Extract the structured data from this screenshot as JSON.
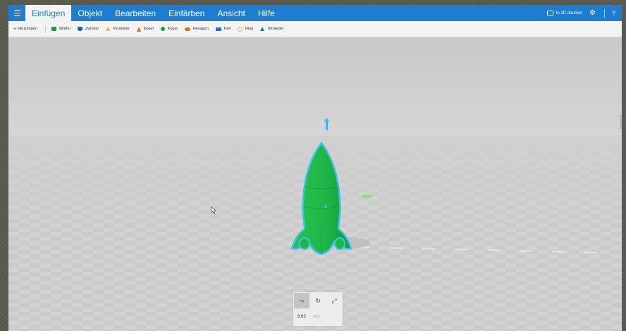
{
  "menubar": {
    "tabs": [
      {
        "label": "Einfügen",
        "active": true
      },
      {
        "label": "Objekt",
        "active": false
      },
      {
        "label": "Bearbeiten",
        "active": false
      },
      {
        "label": "Einfärben",
        "active": false
      },
      {
        "label": "Ansicht",
        "active": false
      },
      {
        "label": "Hilfe",
        "active": false
      }
    ],
    "print_label": "In 3D drucken",
    "gear_icon": "gear-icon",
    "help_icon": "?"
  },
  "toolbar": {
    "add_label": "Hinzufügen",
    "shapes": [
      {
        "label": "Würfel",
        "icon": "cube"
      },
      {
        "label": "Zylinder",
        "icon": "cyl"
      },
      {
        "label": "Pyramide",
        "icon": "pyr"
      },
      {
        "label": "Kegel",
        "icon": "cone"
      },
      {
        "label": "Kugel",
        "icon": "sphere"
      },
      {
        "label": "Hexagon",
        "icon": "hex"
      },
      {
        "label": "Keil",
        "icon": "wedge"
      },
      {
        "label": "Ring",
        "icon": "ring"
      },
      {
        "label": "Tetraeder",
        "icon": "tetra"
      }
    ]
  },
  "colors": {
    "accent": "#1f7dd1",
    "model": "#1fb648",
    "selection_outline": "#3fc2e8"
  },
  "transform_panel": {
    "value": "8,93",
    "unit": "mm"
  }
}
